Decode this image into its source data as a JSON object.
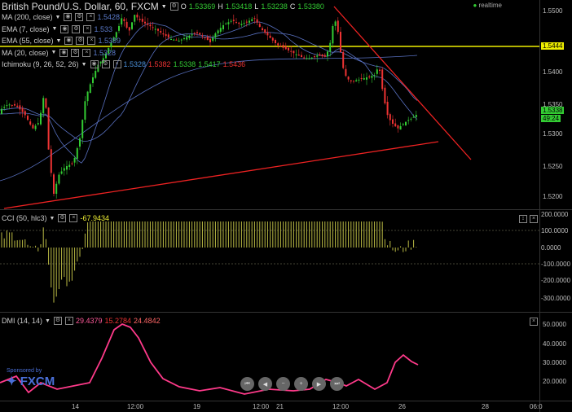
{
  "header": {
    "symbol": "British Pound/U.S. Dollar, 60, FXCM",
    "open_label": "O",
    "open": "1.53369",
    "high_label": "H",
    "high": "1.53418",
    "low_label": "L",
    "low": "1.53238",
    "close_label": "C",
    "close": "1.53380",
    "realtime": "realtime"
  },
  "indicators": [
    {
      "label": "MA (200, close)",
      "value": "1.5428",
      "color": "#5a79c8"
    },
    {
      "label": "EMA (7, close)",
      "value": "1.533",
      "color": "#5a79c8"
    },
    {
      "label": "EMA (55, close)",
      "value": "1.5389",
      "color": "#5a79c8"
    },
    {
      "label": "MA (20, close)",
      "value": "1.5328",
      "color": "#5a79c8"
    }
  ],
  "ichimoku": {
    "label": "Ichimoku (9, 26, 52, 26)",
    "values": [
      {
        "v": "1.5328",
        "color": "#4a8fd8"
      },
      {
        "v": "1.5382",
        "color": "#e33"
      },
      {
        "v": "1.5338",
        "color": "#3c3"
      },
      {
        "v": "1.5417",
        "color": "#3c3"
      },
      {
        "v": "1.5436",
        "color": "#e33"
      }
    ]
  },
  "price_axis": [
    "1.5500",
    "1.5400",
    "1.5350",
    "1.5300",
    "1.5250",
    "1.5200"
  ],
  "price_tags": {
    "level": "1.5444",
    "last": "1.5338",
    "countdown": "49:24"
  },
  "cci": {
    "label": "CCI (50, hlc3)",
    "value": "-67.9434",
    "axis": [
      "200.0000",
      "100.0000",
      "0.0000",
      "-100.0000",
      "-200.0000",
      "-300.0000"
    ]
  },
  "dmi": {
    "label": "DMI (14, 14)",
    "v1": "29.4379",
    "v2": "15.2784",
    "v3": "24.4842",
    "axis": [
      "50.0000",
      "40.0000",
      "30.0000",
      "20.0000"
    ]
  },
  "time_axis": [
    "14",
    "12:00",
    "19",
    "12:00",
    "21",
    "12:00",
    "26",
    "28",
    "06:0"
  ],
  "sponsor": {
    "small": "Sponsored by",
    "brand": "FXCM"
  },
  "colors": {
    "candle_up": "#3c3",
    "candle_down": "#e33",
    "trend": "#e22",
    "level": "#ee0",
    "cci": "#bb4",
    "dmi": "#ff3a8a"
  }
}
